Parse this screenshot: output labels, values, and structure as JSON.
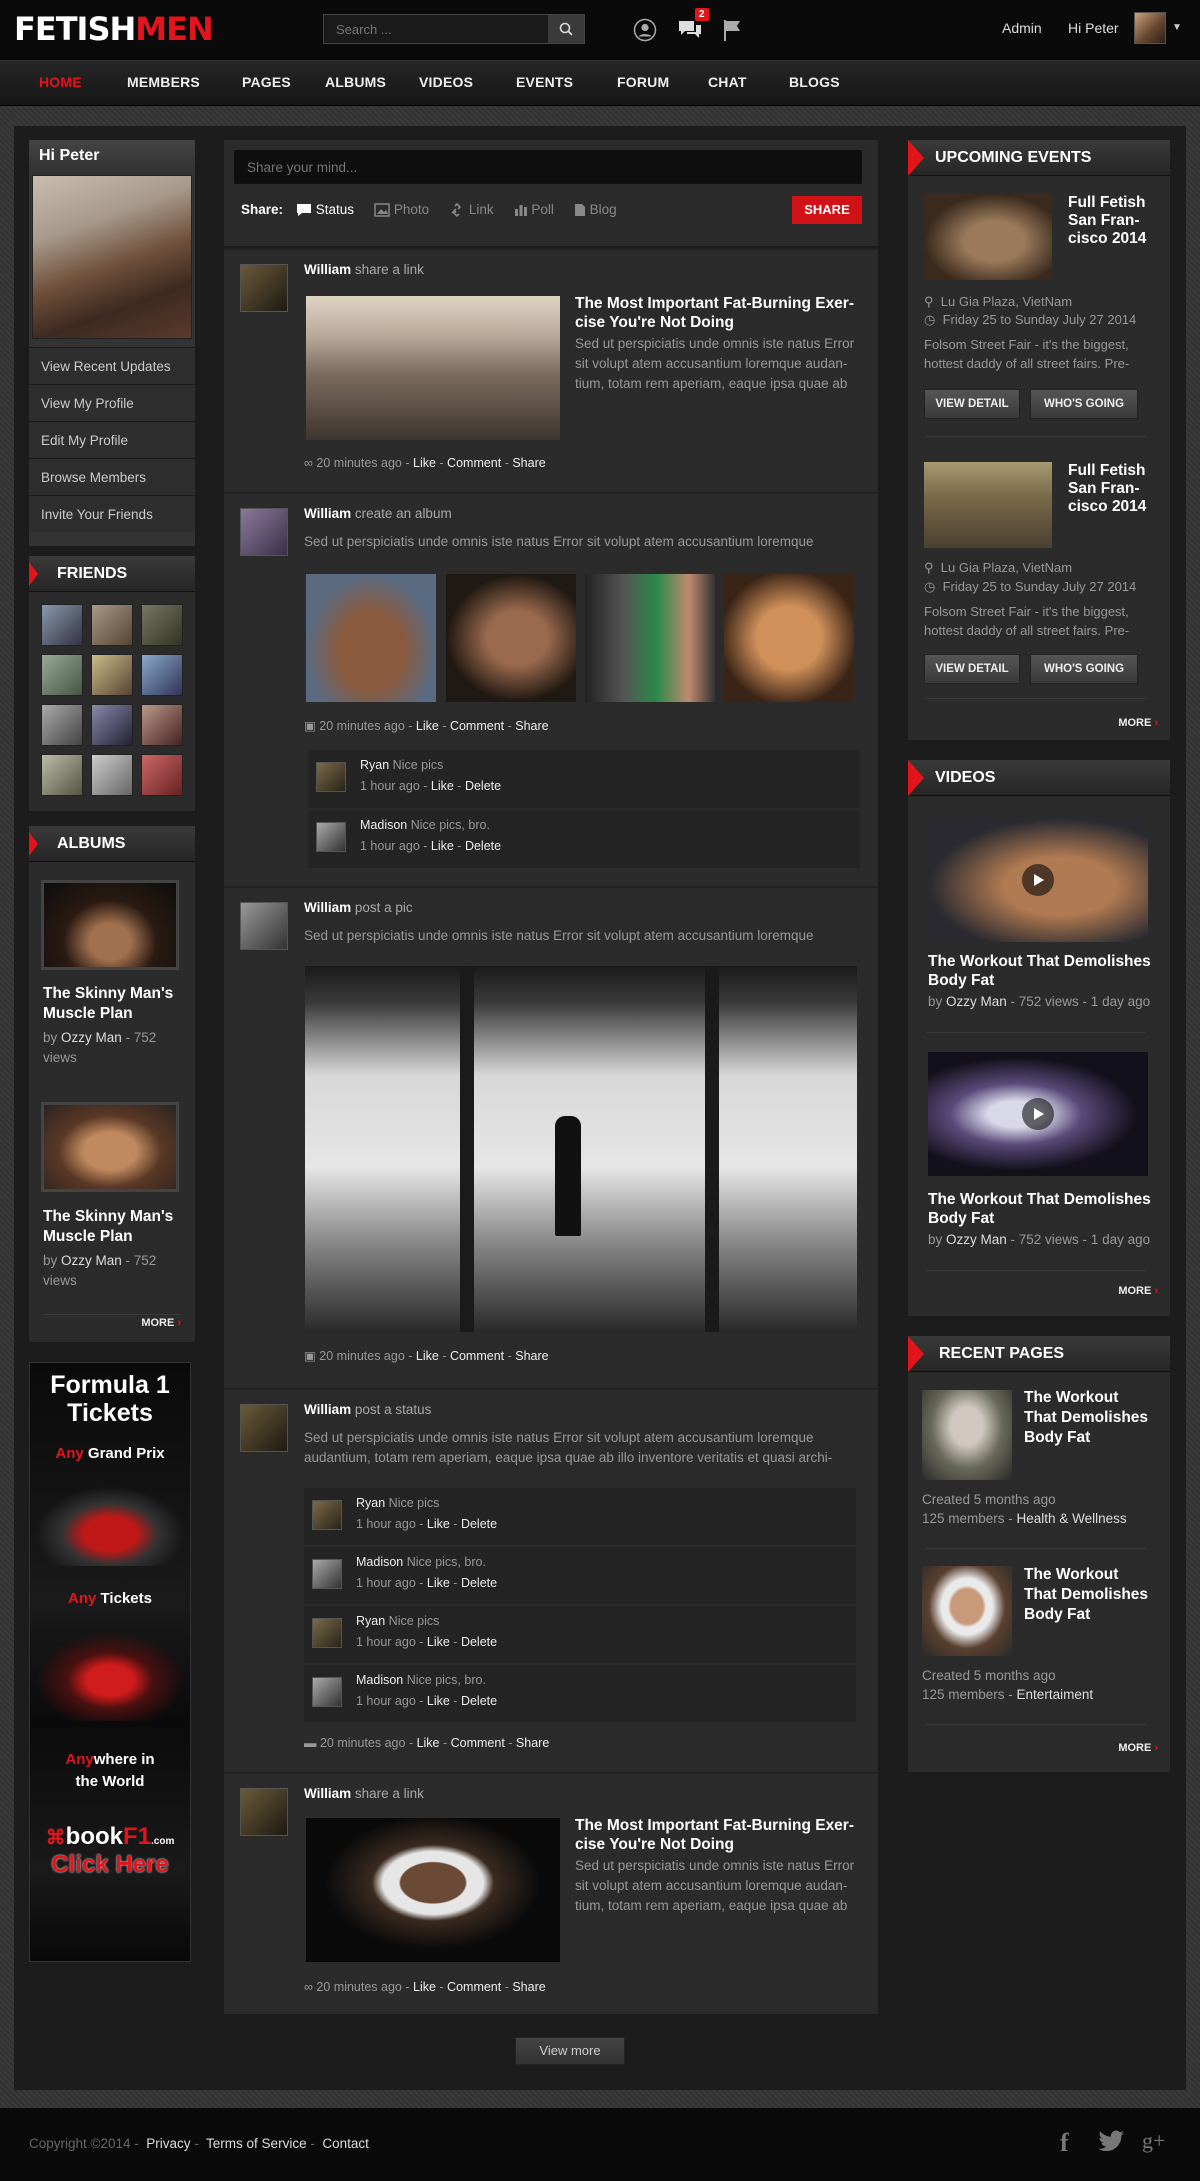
{
  "brand": {
    "left": "FETISH",
    "right": "MEN"
  },
  "search": {
    "placeholder": "Search ..."
  },
  "header": {
    "notif_count": "2",
    "admin": "Admin",
    "greeting": "Hi Peter"
  },
  "nav": [
    "HOME",
    "MEMBERS",
    "PAGES",
    "ALBUMS",
    "VIDEOS",
    "EVENTS",
    "FORUM",
    "CHAT",
    "BLOGS"
  ],
  "user_box": {
    "title": "Hi Peter",
    "menu": [
      "View Recent Updates",
      "View My Profile",
      "Edit My Profile",
      "Browse Members",
      "Invite Your Friends"
    ]
  },
  "friends": {
    "title": "FRIENDS"
  },
  "albums": {
    "title": "ALBUMS",
    "items": [
      {
        "title": "The Skinny Man's Muscle Plan",
        "by": "by",
        "author": "Ozzy Man",
        "views": " - 752 views"
      },
      {
        "title": "The Skinny Man's Muscle Plan",
        "by": "by",
        "author": "Ozzy Man",
        "views": " - 752 views"
      }
    ],
    "more": "MORE"
  },
  "ad": {
    "l1": "Formula 1",
    "l2": "Tickets",
    "l3a": "Any",
    "l3b": " Grand Prix",
    "l4a": "Any",
    "l4b": " Tickets",
    "l5a": "Any",
    "l5b": "where in",
    "l6": "the World",
    "brand_a": "book",
    "brand_b": "F1",
    "brand_c": ".com",
    "cta": "Click Here"
  },
  "composer": {
    "placeholder": "Share your mind...",
    "share_label": "Share:",
    "options": [
      "Status",
      "Photo",
      "Link",
      "Poll",
      "Blog"
    ],
    "button": "SHARE"
  },
  "feed": {
    "posts": [
      {
        "author": "William",
        "action": " share a link",
        "link_title": "The Most Important Fat-Burning Exer- cise You're Not Doing",
        "text": "Sed ut perspiciatis unde omnis iste natus Error sit volupt atem accusantium loremque audan- tium, totam rem aperiam, eaque ipsa quae ab",
        "time": "20 minutes ago"
      },
      {
        "author": "William",
        "action": " create an album",
        "text": "Sed ut perspiciatis unde omnis iste natus Error sit volupt atem accusantium loremque",
        "time": "20 minutes ago"
      },
      {
        "author": "William",
        "action": " post a pic",
        "text": "Sed ut perspiciatis unde omnis iste natus Error sit volupt atem accusantium loremque",
        "time": "20 minutes ago"
      },
      {
        "author": "William",
        "action": " post a status",
        "text": "Sed ut perspiciatis unde omnis iste natus Error sit volupt atem accusantium loremque audantium, totam rem aperiam, eaque ipsa quae ab illo inventore veritatis et quasi archi-",
        "time": "20 minutes ago"
      },
      {
        "author": "William",
        "action": " share a link",
        "link_title": "The Most Important Fat-Burning Exer- cise You're Not Doing",
        "text": "Sed ut perspiciatis unde omnis iste natus Error sit volupt atem accusantium loremque audan- tium, totam rem aperiam, eaque ipsa quae ab",
        "time": "20 minutes ago"
      }
    ],
    "actions": {
      "like": "Like",
      "comment": "Comment",
      "share": "Share",
      "delete": "Delete"
    },
    "comments": [
      {
        "name": "Ryan",
        "text": " Nice pics",
        "time": "1 hour ago"
      },
      {
        "name": "Madison",
        "text": "  Nice pics, bro.",
        "time": "1 hour ago"
      }
    ],
    "view_more": "View more"
  },
  "events": {
    "title": "UPCOMING EVENTS",
    "items": [
      {
        "title": "Full Fetish San Fran- cisco 2014",
        "place": "Lu Gia Plaza, VietNam",
        "date": "Friday 25 to Sunday July 27 2014",
        "desc": "Folsom Street Fair - it's the biggest, hottest daddy of all street fairs. Pre-"
      },
      {
        "title": "Full Fetish San Fran- cisco 2014",
        "place": "Lu Gia Plaza, VietNam",
        "date": "Friday 25 to Sunday July 27 2014",
        "desc": "Folsom Street Fair - it's the biggest, hottest daddy of all street fairs. Pre-"
      }
    ],
    "view_detail": "VIEW DETAIL",
    "whos_going": "WHO'S GOING",
    "more": "MORE"
  },
  "videos": {
    "title": "VIDEOS",
    "items": [
      {
        "title": "The Workout That Demolishes Body Fat",
        "by": "by ",
        "author": "Ozzy Man",
        "meta": " - 752 views - 1 day ago"
      },
      {
        "title": "The Workout That Demolishes Body Fat",
        "by": "by ",
        "author": "Ozzy Man",
        "meta": " - 752 views - 1 day ago"
      }
    ],
    "more": "MORE"
  },
  "recent_pages": {
    "title": "RECENT PAGES",
    "items": [
      {
        "title": "The Workout That Demolishes Body Fat",
        "created": "Created 5 months ago",
        "members": "125 members - ",
        "category": "Health & Wellness"
      },
      {
        "title": "The Workout That Demolishes Body Fat",
        "created": "Created 5 months ago",
        "members": "125 members - ",
        "category": "Entertaiment"
      }
    ],
    "more": "MORE"
  },
  "footer": {
    "copyright": "Copyright ©2014",
    "links": [
      "Privacy",
      "Terms of Service",
      "Contact"
    ]
  },
  "colors": {
    "accent": "#e3141c",
    "background": "#111111",
    "panel": "#2b2b2b"
  }
}
